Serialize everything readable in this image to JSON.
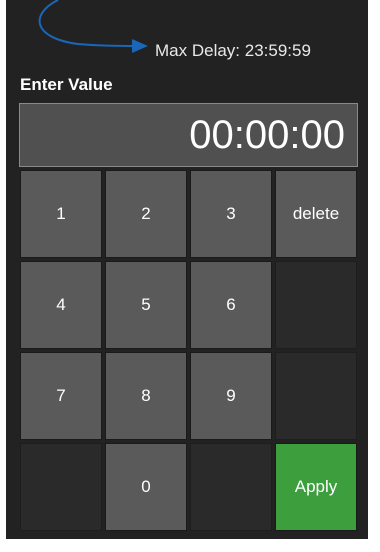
{
  "header": {
    "max_delay": "Max Delay: 23:59:59"
  },
  "input": {
    "label": "Enter Value",
    "value": "00:00:00"
  },
  "keypad": {
    "keys": [
      "1",
      "2",
      "3",
      "delete",
      "4",
      "5",
      "6",
      "",
      "7",
      "8",
      "9",
      "",
      "",
      "0",
      "",
      "Apply"
    ]
  },
  "colors": {
    "panel_bg": "#222222",
    "key_bg": "#5a5a5a",
    "apply_bg": "#3d9e3d",
    "arrow": "#1a66b8"
  },
  "icons": {
    "pointer_arrow": "curved-arrow-icon"
  }
}
